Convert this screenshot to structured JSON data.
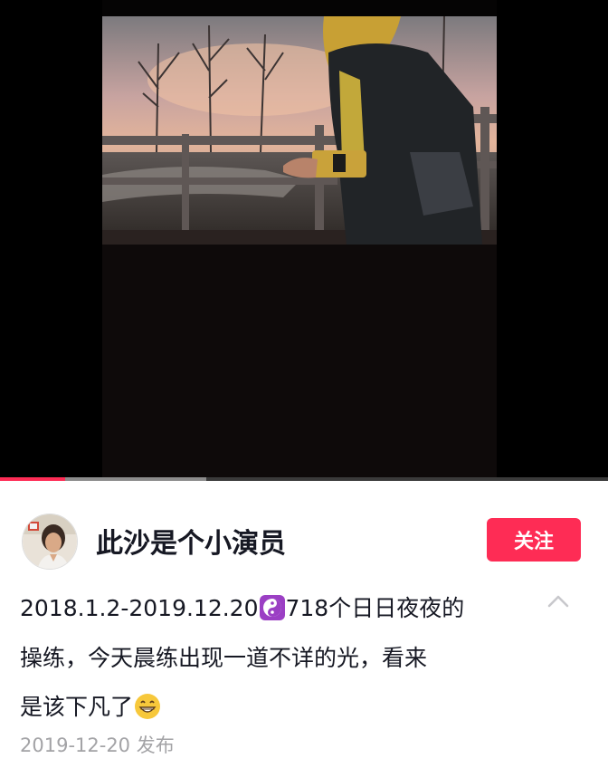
{
  "colors": {
    "accent": "#fe2c55",
    "text": "#161823",
    "muted": "#a3a3a6",
    "progress_buffer": "#8c8c8c",
    "progress_track": "#3a3a3a"
  },
  "video": {
    "progress_fraction": 0.107,
    "buffer_fraction": 0.34
  },
  "author": {
    "name": "此沙是个小演员",
    "follow_label": "关注"
  },
  "post": {
    "caption_line1_a": "2018.1.2-2019.12.20",
    "emoji1": "yin-yang-icon",
    "caption_line1_b": "718个日日夜夜的",
    "caption_line2": "操练，今天晨练出现一道不详的光，看来",
    "caption_line3": "是该下凡了",
    "emoji2": "grinning-face-icon",
    "date": "2019-12-20",
    "date_suffix": "发布"
  }
}
